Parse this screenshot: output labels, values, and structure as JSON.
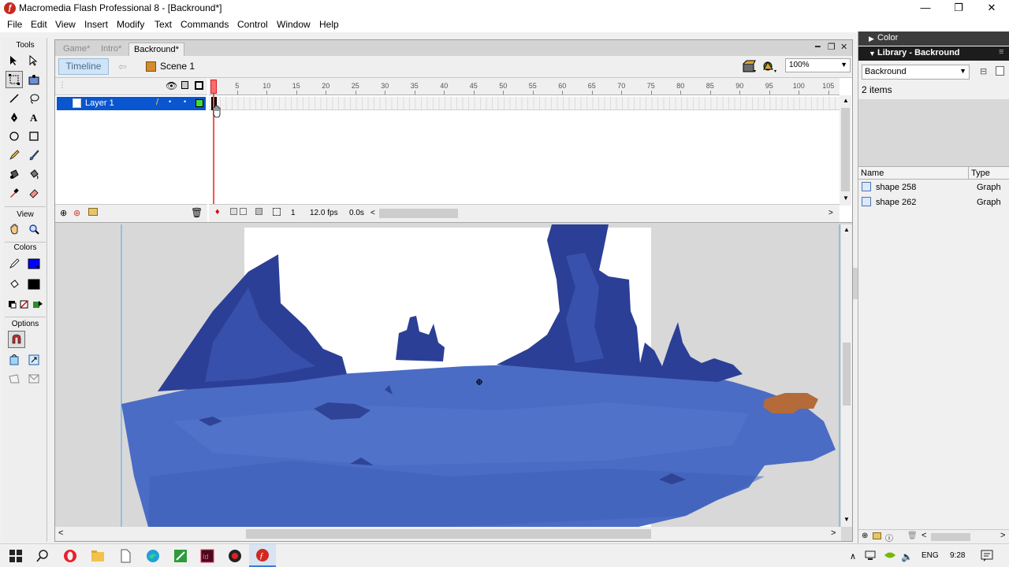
{
  "window": {
    "title": "Macromedia Flash Professional 8 - [Backround*]",
    "minimize": "—",
    "restore": "❐",
    "close": "✕"
  },
  "menu": [
    "File",
    "Edit",
    "View",
    "Insert",
    "Modify",
    "Text",
    "Commands",
    "Control",
    "Window",
    "Help"
  ],
  "tools": {
    "title": "Tools",
    "view_label": "View",
    "colors_label": "Colors",
    "options_label": "Options",
    "stroke_color": "#000000",
    "fill_color": "#0000ff"
  },
  "document": {
    "tabs": [
      "Game*",
      "Intro*",
      "Backround*"
    ],
    "timeline_button": "Timeline",
    "scene_label": "Scene 1",
    "zoom": "100%"
  },
  "timeline": {
    "layer_name": "Layer 1",
    "frame_numbers": [
      "5",
      "10",
      "15",
      "20",
      "25",
      "30",
      "35",
      "40",
      "45",
      "50",
      "55",
      "60",
      "65",
      "70",
      "75",
      "80",
      "85",
      "90",
      "95",
      "100",
      "105"
    ],
    "current_frame": "1",
    "frame_rate": "12.0 fps",
    "elapsed_time": "0.0s"
  },
  "panels": {
    "color_title": "Color",
    "library_title": "Library - Backround",
    "library_select": "Backround",
    "item_count": "2 items",
    "col_name": "Name",
    "col_type": "Type",
    "items": [
      {
        "name": "shape 258",
        "type": "Graph"
      },
      {
        "name": "shape 262",
        "type": "Graph"
      }
    ]
  },
  "taskbar": {
    "language": "ENG",
    "time": "9:28"
  },
  "colors": {
    "selection_blue": "#0a55d0",
    "stage_blue": "#4a6cc4",
    "mountain_dark": "#2c3f96",
    "rock_orange": "#b56a3a"
  }
}
